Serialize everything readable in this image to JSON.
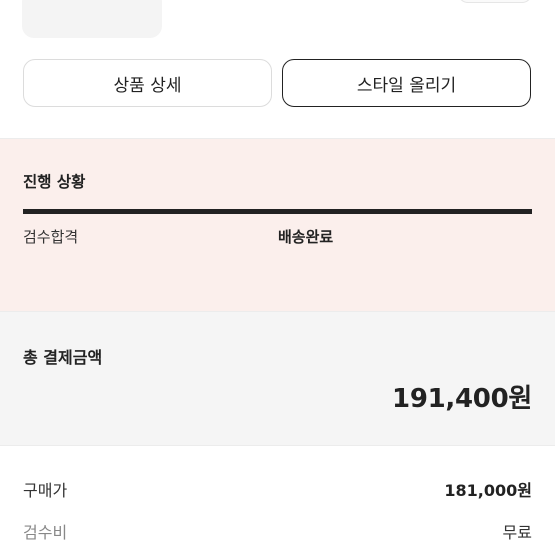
{
  "actions": {
    "product_detail_label": "상품 상세",
    "upload_style_label": "스타일 올리기"
  },
  "progress": {
    "title": "진행 상황",
    "progress_value": 1.0,
    "steps": [
      "검수합격",
      "배송완료"
    ]
  },
  "payment": {
    "total_label": "총 결제금액",
    "total_amount": "191,400원",
    "rows": [
      {
        "label": "구매가",
        "value": "181,000원"
      },
      {
        "label": "검수비",
        "value": "무료"
      }
    ]
  },
  "icons": [
    "product-thumbnail-image"
  ]
}
